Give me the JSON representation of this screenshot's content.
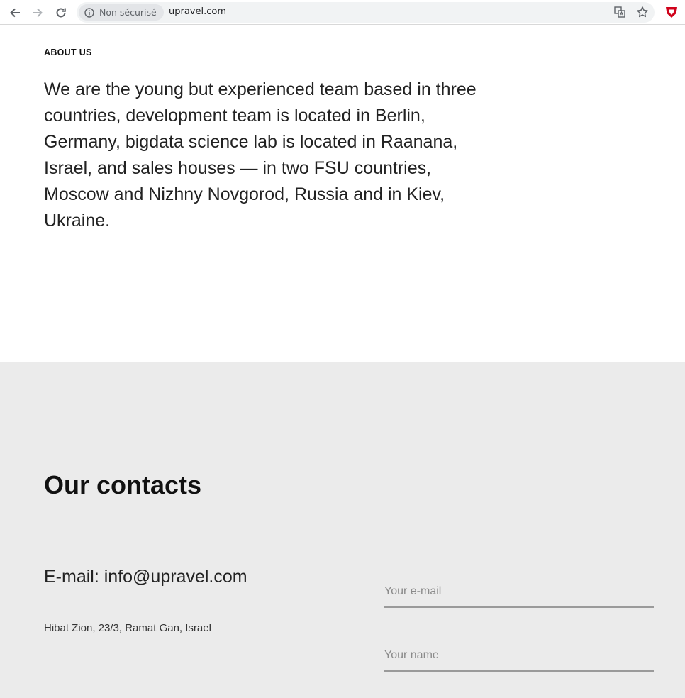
{
  "browser": {
    "security_label": "Non sécurisé",
    "url": "upravel.com",
    "icons": [
      "back-arrow-icon",
      "forward-arrow-icon",
      "reload-icon",
      "info-icon",
      "translate-icon",
      "star-icon",
      "shield-extension-icon"
    ],
    "extension_color": "#d0021b"
  },
  "about": {
    "heading": "ABOUT US",
    "text": "We are the young but experienced team based in three countries, development team is located in Berlin, Germany, bigdata science lab is located in Raanana, Israel, and sales houses — in two FSU countries, Moscow and Nizhny Novgorod, Russia and in Kiev, Ukraine."
  },
  "contacts": {
    "title": "Our contacts",
    "email_line": "E-mail: info@upravel.com",
    "address": "Hibat Zion, 23/3, Ramat Gan, Israel",
    "form": {
      "email_placeholder": "Your e-mail",
      "name_placeholder": "Your name"
    },
    "background": "#ebebeb"
  }
}
